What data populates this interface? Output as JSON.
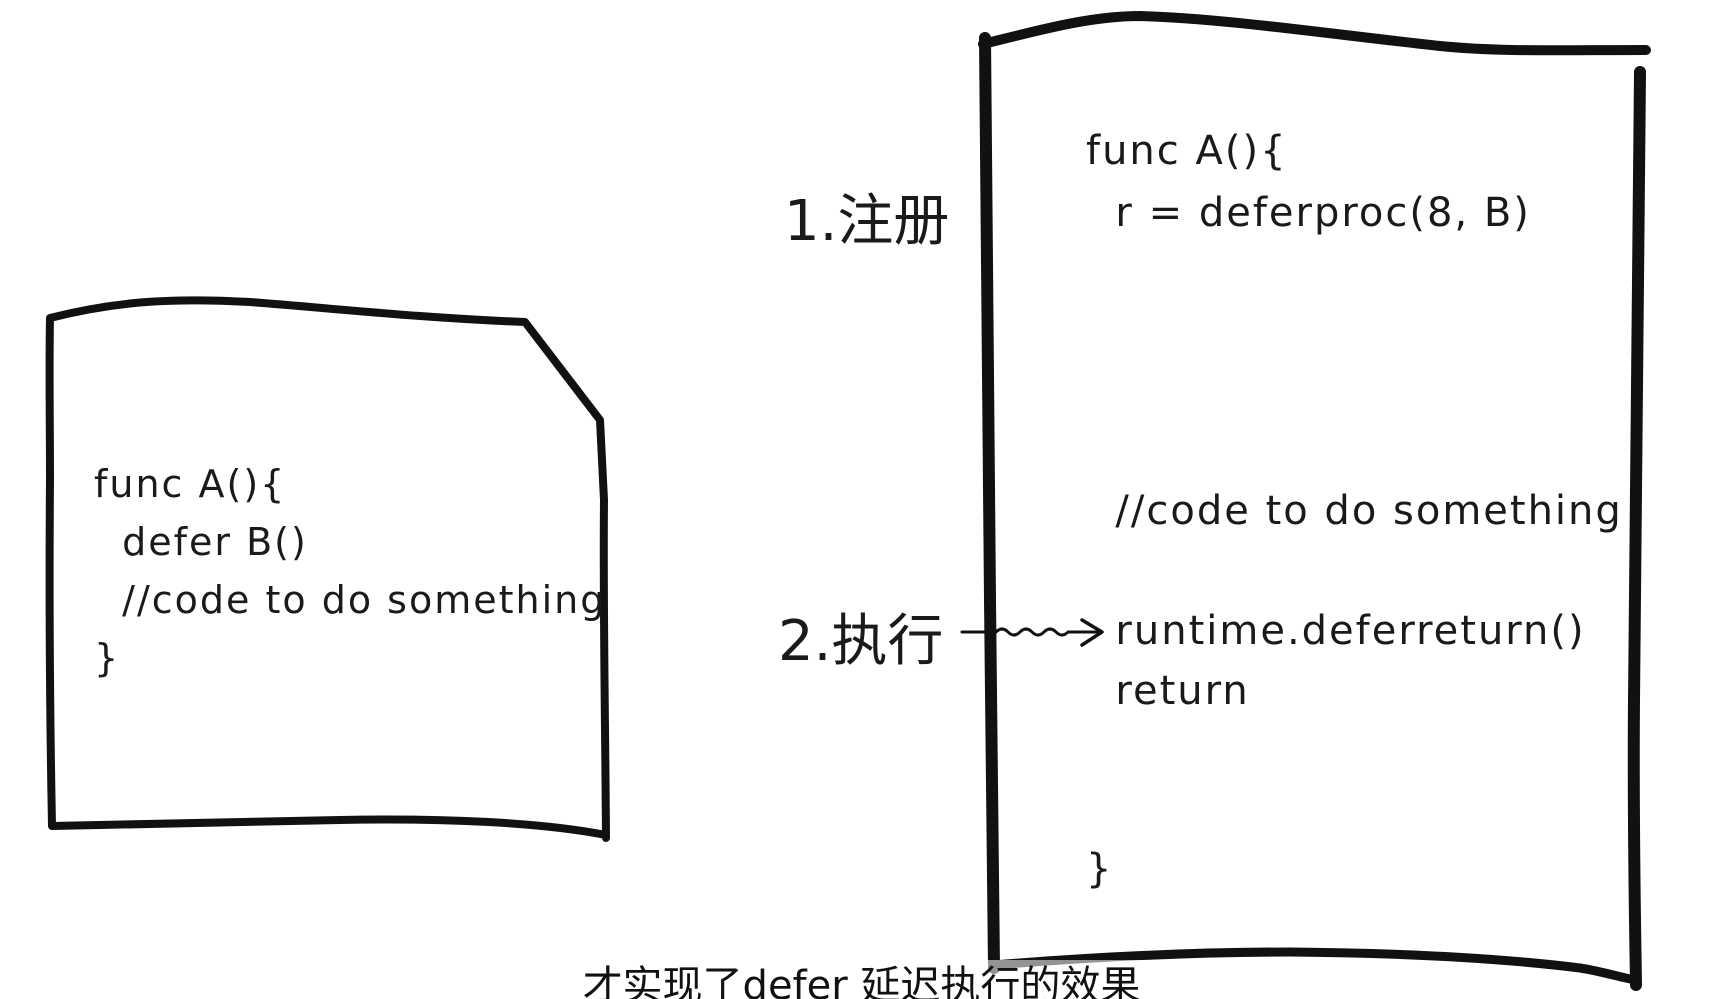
{
  "left_box": {
    "code_lines": [
      "func A(){",
      "  defer B()",
      "  //code to do something",
      "}"
    ]
  },
  "right_box": {
    "code_lines": [
      "func A(){",
      "  r = deferproc(8, B)",
      "  //code to do something",
      "  runtime.deferreturn()",
      "  return",
      "}"
    ]
  },
  "steps": {
    "register": "1.注册",
    "execute": "2.执行"
  },
  "subtitle": "才实现了defer 延迟执行的效果",
  "colors": {
    "ink": "#111111",
    "background": "#ffffff"
  }
}
